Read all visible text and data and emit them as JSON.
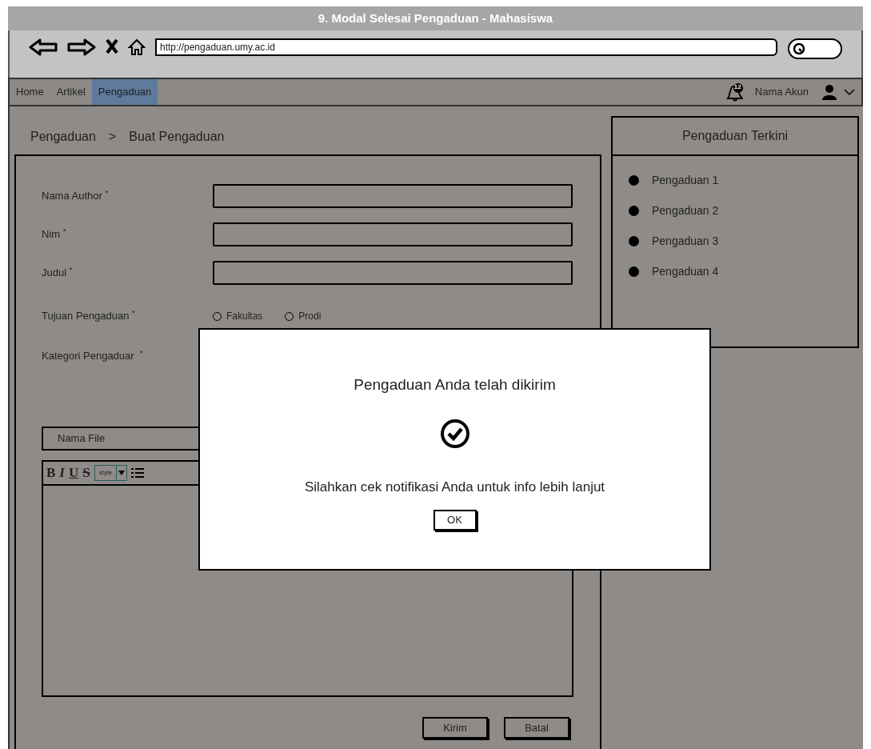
{
  "window": {
    "title": "9. Modal Selesai Pengaduan - Mahasiswa"
  },
  "browser": {
    "url": "http://pengaduan.umy.ac.id"
  },
  "nav": {
    "items": [
      {
        "label": "Home",
        "selected": false
      },
      {
        "label": "Artikel",
        "selected": false
      },
      {
        "label": "Pengaduan",
        "selected": true
      }
    ],
    "notification_count": "12",
    "account": "Nama Akun"
  },
  "breadcrumb": {
    "items": [
      "Pengaduan",
      "Buat Pengaduan"
    ],
    "separator": ">"
  },
  "form": {
    "fields": [
      {
        "kind": "text",
        "label": "Nama Author $^{*}$"
      },
      {
        "kind": "text",
        "label": "Nim $^{*}$"
      },
      {
        "kind": "text",
        "label": "Judul $^{*}$"
      },
      {
        "kind": "radio",
        "label": "Tujuan Pengaduan $^{*}$",
        "options": [
          {
            "label": "Fakultas",
            "selected": false
          },
          {
            "label": "Prodi",
            "selected": false
          }
        ]
      },
      {
        "kind": "category",
        "label": "Kategori Pengaduar  $^{*}$"
      }
    ],
    "file_field": {
      "placeholder": "Nama File"
    },
    "editor": {
      "toolbar": [
        "B",
        "I",
        "U",
        "S"
      ],
      "style_dropdown": "style"
    },
    "buttons": [
      "Kirim",
      "Batal"
    ]
  },
  "sidebar": {
    "title": "Pengaduan Terkini",
    "items": [
      "Pengaduan 1",
      "Pengaduan 2",
      "Pengaduan 3",
      "Pengaduan 4"
    ]
  },
  "modal": {
    "title": "Pengaduan Anda telah dikirim",
    "message": "Silahkan cek notifikasi Anda untuk info lebih lanjut",
    "button": "OK"
  }
}
